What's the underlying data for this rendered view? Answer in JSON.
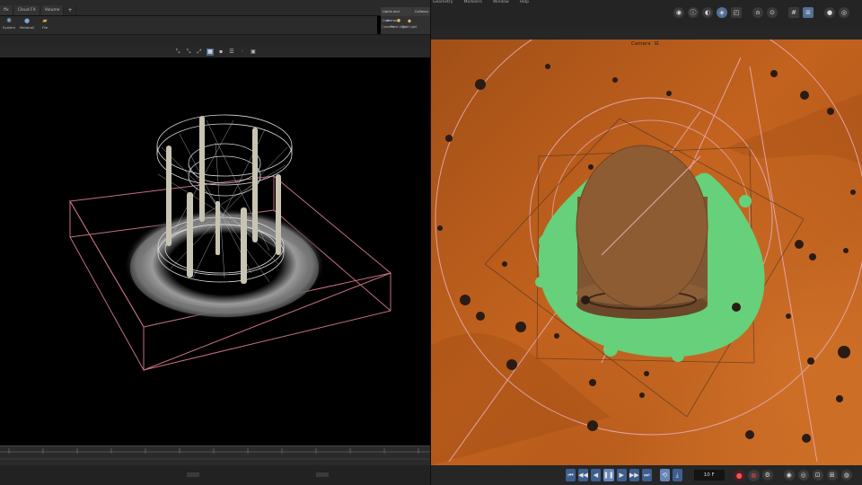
{
  "left_pane": {
    "tabs": [
      "ffx",
      "Cloud FX",
      "Volume"
    ],
    "add_tab": "+",
    "shelf_tools": [
      {
        "label": "System",
        "icon": "system-icon"
      },
      {
        "label": "Metaball",
        "icon": "metaball-icon"
      },
      {
        "label": "File",
        "icon": "file-icon"
      }
    ],
    "lights_tabs": [
      "Lights and Cameras",
      "Collision"
    ],
    "lights_tools": [
      {
        "label": "Camera",
        "icon": "camera-icon"
      },
      {
        "label": "Point Light",
        "icon": "point-light-icon"
      },
      {
        "label": "Spot Light",
        "icon": "spot-light-icon"
      }
    ],
    "viewport_tools": [
      "⤡",
      "⤡",
      "⤢",
      "▦",
      "▪",
      "☰",
      "·",
      "▣"
    ]
  },
  "right_pane": {
    "menu": [
      "Geometry",
      "Modelers",
      "Window",
      "Help"
    ],
    "camera_label": "Camera",
    "camera_lock_icon": "⊟",
    "frame_value": "10 F",
    "play_icons": [
      "⏮",
      "◀◀",
      "◀",
      "❚❚",
      "▶",
      "▶▶",
      "⏭"
    ],
    "loop_icons": [
      "⟲",
      "⤓"
    ],
    "colors": {
      "ground": "#c2621e",
      "green_mask": "#66d07a",
      "cylinder": "#8a5a34",
      "guide_lines": "#e6a9b4"
    }
  }
}
